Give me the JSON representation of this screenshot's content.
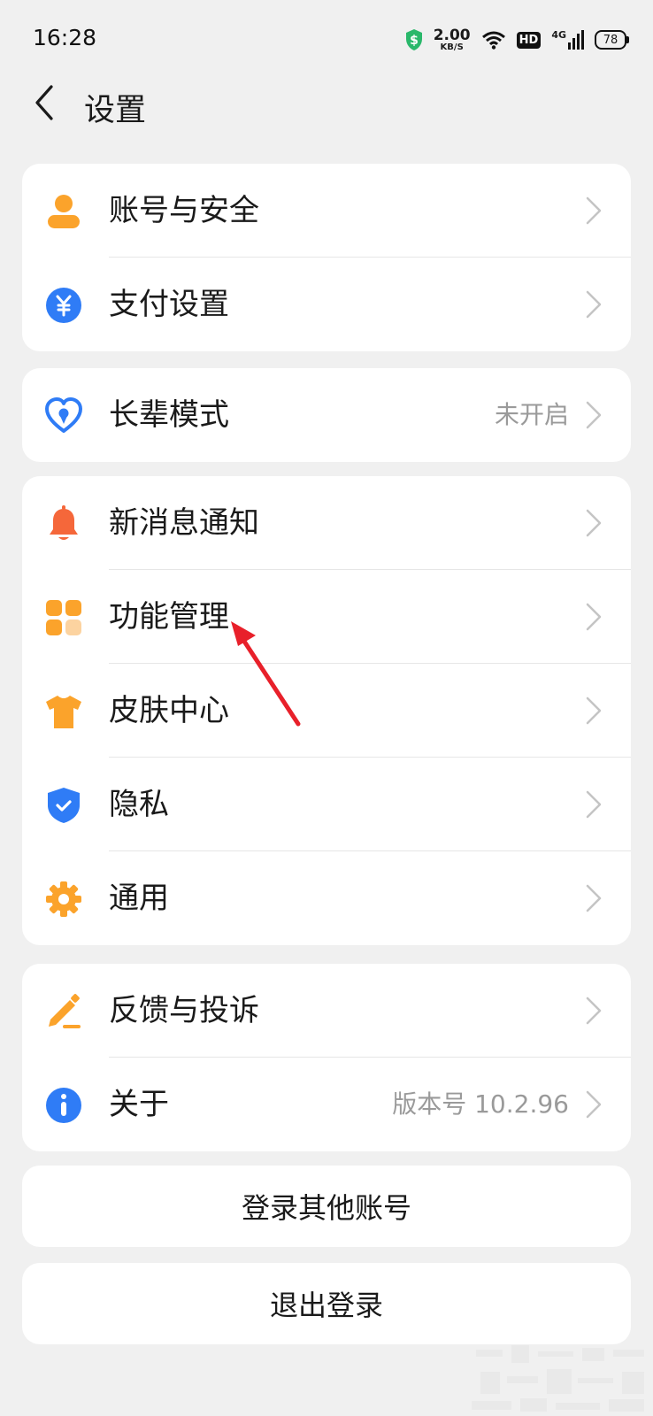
{
  "status_bar": {
    "time": "16:28",
    "net_speed_value": "2.00",
    "net_speed_unit": "KB/S",
    "hd_label": "HD",
    "network_type": "4G",
    "battery_level": "78"
  },
  "header": {
    "title": "设置"
  },
  "groups": {
    "account": [
      {
        "label": "账号与安全"
      },
      {
        "label": "支付设置"
      }
    ],
    "elder": [
      {
        "label": "长辈模式",
        "value": "未开启"
      }
    ],
    "features": [
      {
        "label": "新消息通知"
      },
      {
        "label": "功能管理"
      },
      {
        "label": "皮肤中心"
      },
      {
        "label": "隐私"
      },
      {
        "label": "通用"
      }
    ],
    "support": [
      {
        "label": "反馈与投诉"
      },
      {
        "label": "关于",
        "value": "版本号 10.2.96"
      }
    ]
  },
  "buttons": {
    "switch_account": "登录其他账号",
    "logout": "退出登录"
  },
  "colors": {
    "background": "#f0f0f0",
    "orange": "#fba32b",
    "blue": "#2f7cf6",
    "red_orange": "#f5673a",
    "annotation_red": "#e8202a"
  }
}
